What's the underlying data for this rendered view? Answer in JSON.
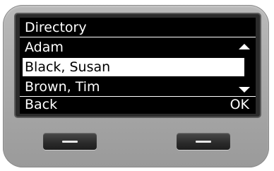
{
  "screen": {
    "title": "Directory",
    "entries": [
      {
        "name": "Adam",
        "selected": false
      },
      {
        "name": "Black, Susan",
        "selected": true
      },
      {
        "name": "Brown, Tim",
        "selected": false
      }
    ],
    "softkeys": {
      "left": "Back",
      "right": "OK"
    },
    "scroll_up_icon": "triangle-up",
    "scroll_down_icon": "triangle-down"
  },
  "colors": {
    "screen_bg": "#000000",
    "text": "#ffffff",
    "selection_bg": "#ffffff",
    "device_body": "#a8a8a8",
    "hardware_key": "#2a2a2a"
  }
}
